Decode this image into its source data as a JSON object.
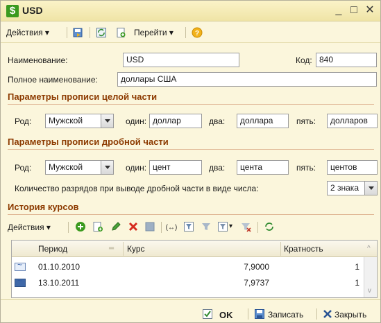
{
  "window": {
    "title": "USD",
    "title_icon": "dollar-sign-icon",
    "minimize": "_",
    "maximize": "□",
    "close": "✕"
  },
  "toolbar": {
    "actions_label": "Действия",
    "goto_label": "Перейти",
    "help_icon": "help-icon"
  },
  "form": {
    "name_label": "Наименование:",
    "name_value": "USD",
    "code_label": "Код:",
    "code_value": "840",
    "fullname_label": "Полное наименование:",
    "fullname_value": "доллары США"
  },
  "integer_part": {
    "section_title": "Параметры прописи целой части",
    "gender_label": "Род:",
    "gender_value": "Мужской",
    "one_label": "один:",
    "one_value": "доллар",
    "two_label": "два:",
    "two_value": "доллара",
    "five_label": "пять:",
    "five_value": "долларов"
  },
  "fraction_part": {
    "section_title": "Параметры прописи дробной части",
    "gender_label": "Род:",
    "gender_value": "Мужской",
    "one_label": "один:",
    "one_value": "цент",
    "two_label": "два:",
    "two_value": "цента",
    "five_label": "пять:",
    "five_value": "центов",
    "digits_label": "Количество разрядов при выводе дробной части в виде числа:",
    "digits_value": "2 знака"
  },
  "history": {
    "section_title": "История курсов",
    "actions_label": "Действия",
    "columns": [
      "Период",
      "Курс",
      "Кратность"
    ],
    "rows": [
      {
        "period": "01.10.2010",
        "rate": "7,9000",
        "multiplicity": "1"
      },
      {
        "period": "13.10.2011",
        "rate": "7,9737",
        "multiplicity": "1"
      }
    ]
  },
  "footer": {
    "ok_label": "OK",
    "save_label": "Записать",
    "close_label": "Закрыть"
  },
  "colors": {
    "window_bg": "#fbf6dc",
    "section_title": "#8c3a00",
    "selected_row": "#3f68a8"
  }
}
